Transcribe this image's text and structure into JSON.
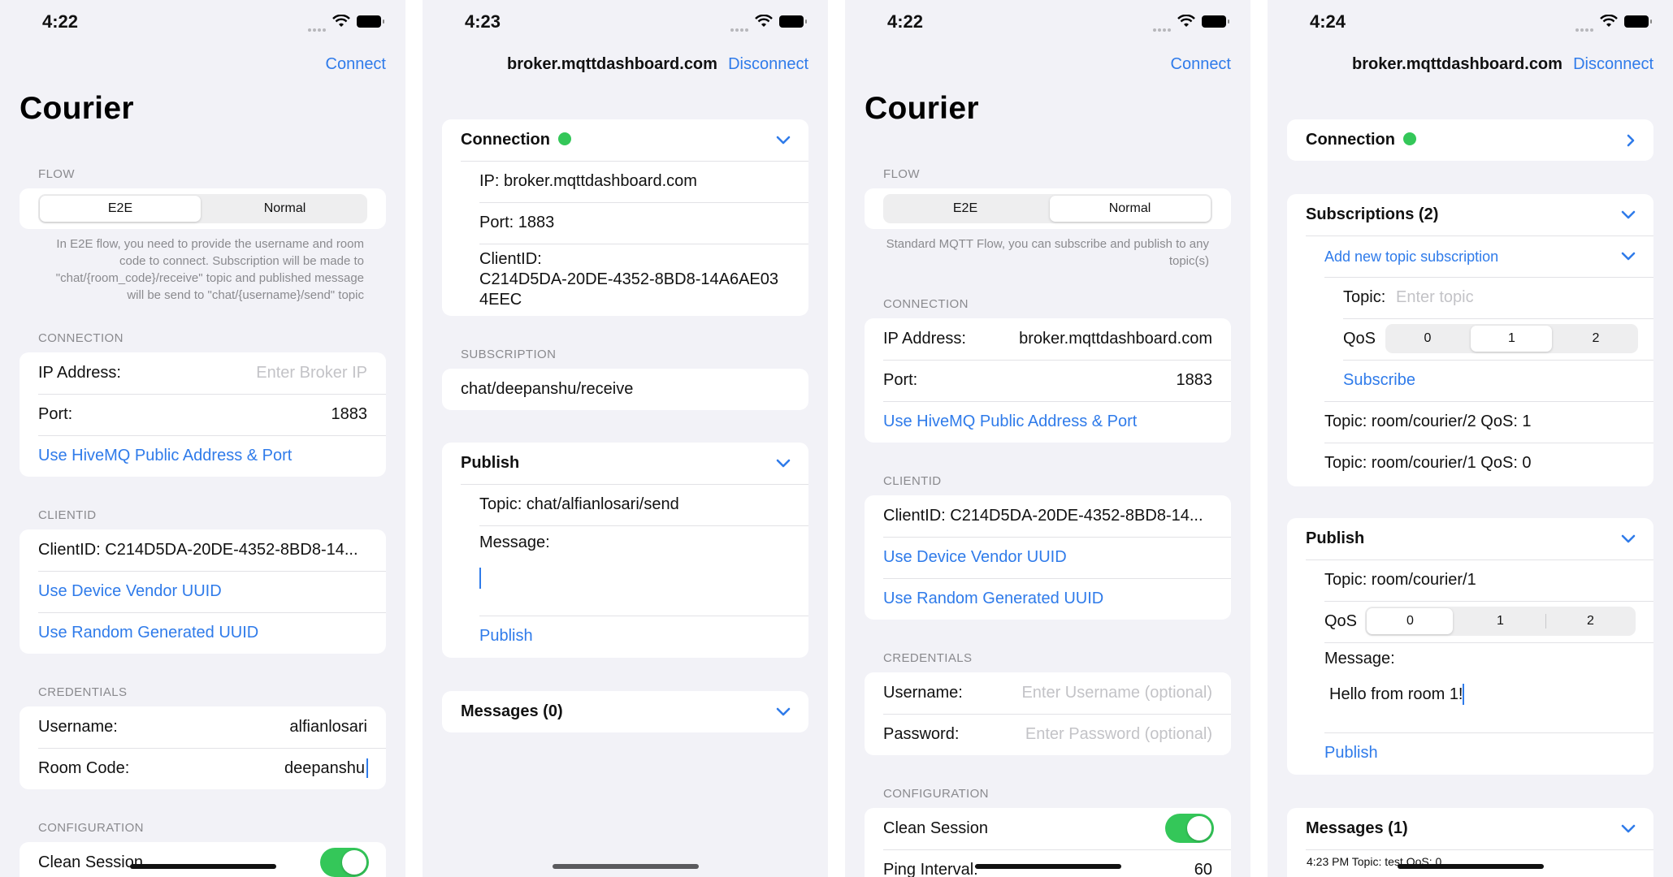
{
  "screens": [
    {
      "time": "4:22",
      "nav_right": "Connect",
      "title": "Courier",
      "flow_header": "FLOW",
      "flow_options": [
        "E2E",
        "Normal"
      ],
      "flow_selected": "E2E",
      "flow_note": "In E2E flow, you need to provide the username and room code to connect. Subscription will be made to \"chat/{room_code}/receive\" topic and published message will be send to \"chat/{username}/send\" topic",
      "connection_header": "CONNECTION",
      "ip_label": "IP Address:",
      "ip_placeholder": "Enter Broker IP",
      "port_label": "Port:",
      "port_value": "1883",
      "hivemq_link": "Use HiveMQ Public Address & Port",
      "clientid_header": "CLIENTID",
      "clientid_text": "ClientID:  C214D5DA-20DE-4352-8BD8-14...",
      "vendor_uuid": "Use Device Vendor UUID",
      "random_uuid": "Use Random Generated UUID",
      "credentials_header": "CREDENTIALS",
      "username_label": "Username:",
      "username_value": "alfianlosari",
      "roomcode_label": "Room Code:",
      "roomcode_value": "deepanshu",
      "configuration_header": "CONFIGURATION",
      "clean_session_label": "Clean Session",
      "clean_session_on": true
    },
    {
      "time": "4:23",
      "nav_title": "broker.mqttdashboard.com",
      "nav_right": "Disconnect",
      "connection_label": "Connection",
      "connection_status_color": "#34c759",
      "ip_text": "IP: broker.mqttdashboard.com",
      "port_text": "Port: 1883",
      "clientid_text": "ClientID:\nC214D5DA-20DE-4352-8BD8-14A6AE03\n4EEC",
      "subscription_header": "SUBSCRIPTION",
      "subscription_topic": "chat/deepanshu/receive",
      "publish_label": "Publish",
      "publish_topic": "Topic: chat/alfianlosari/send",
      "message_label": "Message:",
      "publish_button": "Publish",
      "messages_label": "Messages (0)"
    },
    {
      "time": "4:22",
      "nav_right": "Connect",
      "title": "Courier",
      "flow_header": "FLOW",
      "flow_options": [
        "E2E",
        "Normal"
      ],
      "flow_selected": "Normal",
      "flow_note": "Standard MQTT Flow, you can subscribe and publish to any topic(s)",
      "connection_header": "CONNECTION",
      "ip_label": "IP Address:",
      "ip_value": "broker.mqttdashboard.com",
      "port_label": "Port:",
      "port_value": "1883",
      "hivemq_link": "Use HiveMQ Public Address & Port",
      "clientid_header": "CLIENTID",
      "clientid_text": "ClientID:  C214D5DA-20DE-4352-8BD8-14...",
      "vendor_uuid": "Use Device Vendor UUID",
      "random_uuid": "Use Random Generated UUID",
      "credentials_header": "CREDENTIALS",
      "username_label": "Username:",
      "username_placeholder": "Enter Username (optional)",
      "password_label": "Password:",
      "password_placeholder": "Enter Password (optional)",
      "configuration_header": "CONFIGURATION",
      "clean_session_label": "Clean Session",
      "clean_session_on": true,
      "ping_label": "Ping Interval:",
      "ping_value": "60"
    },
    {
      "time": "4:24",
      "nav_title": "broker.mqttdashboard.com",
      "nav_right": "Disconnect",
      "connection_label": "Connection",
      "connection_status_color": "#34c759",
      "subscriptions_label": "Subscriptions (2)",
      "add_subscription": "Add new topic subscription",
      "topic_label": "Topic:",
      "topic_placeholder": "Enter topic",
      "qos_label": "QoS",
      "sub_qos_options": [
        "0",
        "1",
        "2"
      ],
      "sub_qos_selected": "1",
      "subscribe_button": "Subscribe",
      "subscriptions": [
        "Topic: room/courier/2  QoS: 1",
        "Topic: room/courier/1  QoS: 0"
      ],
      "publish_label": "Publish",
      "publish_topic": "Topic:  room/courier/1",
      "pub_qos_options": [
        "0",
        "1",
        "2"
      ],
      "pub_qos_selected": "0",
      "message_label": "Message:",
      "message_value": "Hello from room 1!",
      "publish_button": "Publish",
      "messages_label": "Messages (1)",
      "message_meta": "4:23 PM  Topic: test  QoS: 0"
    }
  ],
  "colors": {
    "accent": "#2f7bea",
    "status_green": "#34c759",
    "background": "#f2f2f7"
  }
}
